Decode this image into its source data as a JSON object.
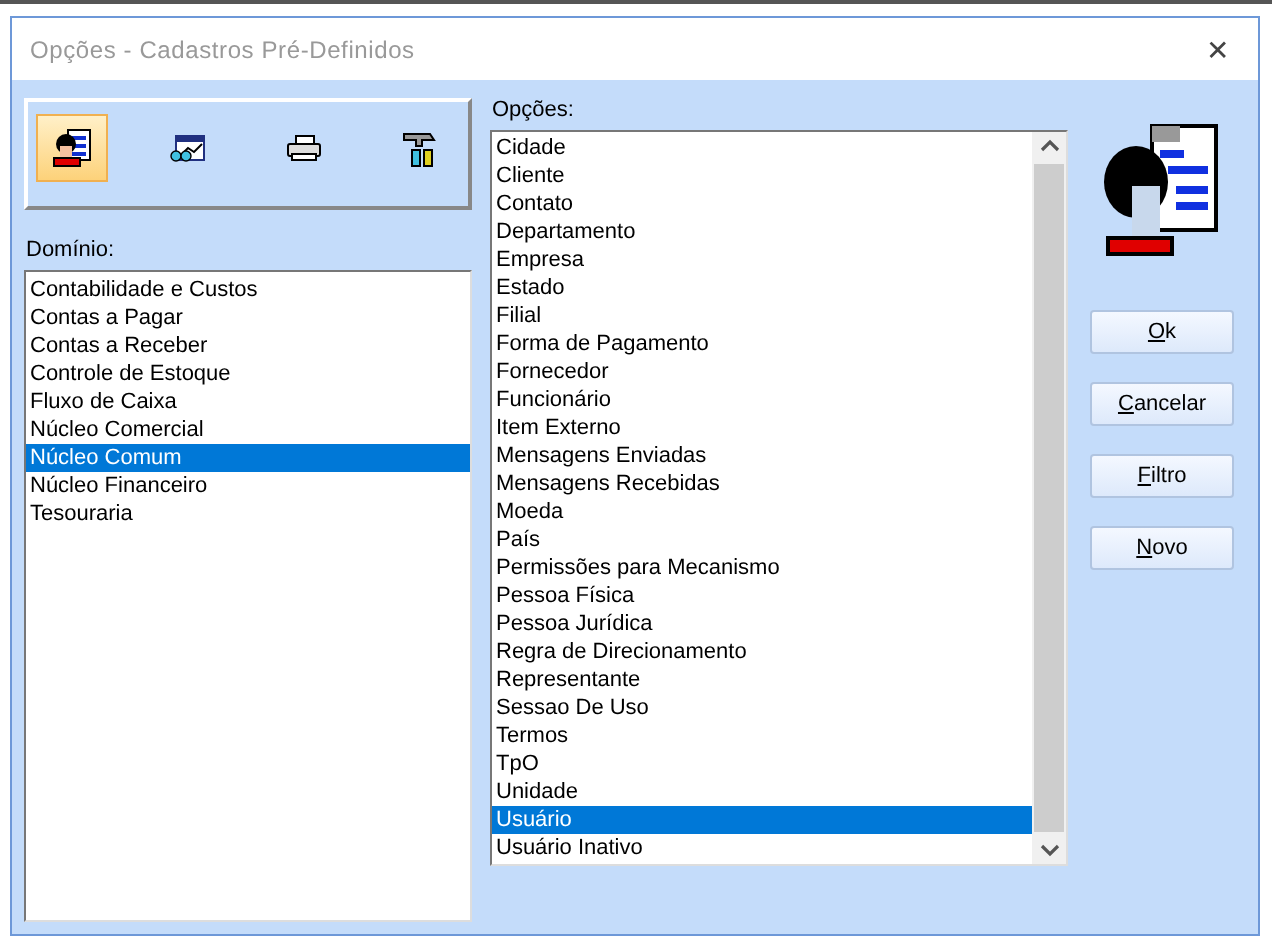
{
  "window": {
    "title": "Opções - Cadastros Pré-Definidos",
    "close": "✕"
  },
  "toolbar": [
    {
      "kind": "person",
      "selected": true
    },
    {
      "kind": "chart",
      "selected": false
    },
    {
      "kind": "printer",
      "selected": false
    },
    {
      "kind": "tools",
      "selected": false
    }
  ],
  "domain": {
    "label": "Domínio:",
    "items": [
      {
        "label": "Contabilidade e Custos",
        "selected": false
      },
      {
        "label": "Contas a Pagar",
        "selected": false
      },
      {
        "label": "Contas a Receber",
        "selected": false
      },
      {
        "label": "Controle de Estoque",
        "selected": false
      },
      {
        "label": "Fluxo de Caixa",
        "selected": false
      },
      {
        "label": "Núcleo Comercial",
        "selected": false
      },
      {
        "label": "Núcleo Comum",
        "selected": true
      },
      {
        "label": "Núcleo Financeiro",
        "selected": false
      },
      {
        "label": "Tesouraria",
        "selected": false
      }
    ]
  },
  "options": {
    "label": "Opções:",
    "items": [
      {
        "label": "Cidade",
        "selected": false
      },
      {
        "label": "Cliente",
        "selected": false
      },
      {
        "label": "Contato",
        "selected": false
      },
      {
        "label": "Departamento",
        "selected": false
      },
      {
        "label": "Empresa",
        "selected": false
      },
      {
        "label": "Estado",
        "selected": false
      },
      {
        "label": "Filial",
        "selected": false
      },
      {
        "label": "Forma de Pagamento",
        "selected": false
      },
      {
        "label": "Fornecedor",
        "selected": false
      },
      {
        "label": "Funcionário",
        "selected": false
      },
      {
        "label": "Item Externo",
        "selected": false
      },
      {
        "label": "Mensagens Enviadas",
        "selected": false
      },
      {
        "label": "Mensagens Recebidas",
        "selected": false
      },
      {
        "label": "Moeda",
        "selected": false
      },
      {
        "label": "País",
        "selected": false
      },
      {
        "label": "Permissões para Mecanismo",
        "selected": false
      },
      {
        "label": "Pessoa Física",
        "selected": false
      },
      {
        "label": "Pessoa Jurídica",
        "selected": false
      },
      {
        "label": "Regra de Direcionamento",
        "selected": false
      },
      {
        "label": "Representante",
        "selected": false
      },
      {
        "label": "Sessao De Uso",
        "selected": false
      },
      {
        "label": "Termos",
        "selected": false
      },
      {
        "label": "TpO",
        "selected": false
      },
      {
        "label": "Unidade",
        "selected": false
      },
      {
        "label": "Usuário",
        "selected": true
      },
      {
        "label": "Usuário Inativo",
        "selected": false
      }
    ]
  },
  "buttons": [
    {
      "label": "Ok"
    },
    {
      "label": "Cancelar"
    },
    {
      "label": "Filtro"
    },
    {
      "label": "Novo"
    }
  ]
}
